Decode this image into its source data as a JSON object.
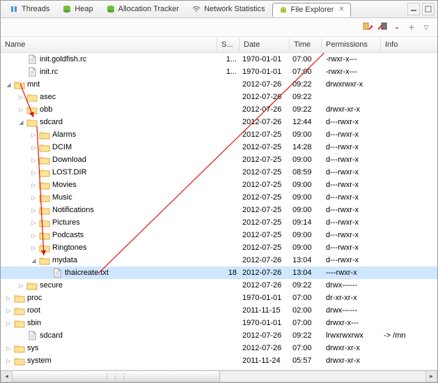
{
  "tabs": [
    {
      "label": "Threads",
      "icon": "threads"
    },
    {
      "label": "Heap",
      "icon": "heap"
    },
    {
      "label": "Allocation Tracker",
      "icon": "heap"
    },
    {
      "label": "Network Statistics",
      "icon": "net"
    },
    {
      "label": "File Explorer",
      "icon": "android",
      "active": true
    }
  ],
  "toolbar": {
    "push_label": "push-file",
    "pull_label": "pull-file",
    "delete_label": "-",
    "add_label": "+"
  },
  "columns": {
    "name": "Name",
    "size": "S...",
    "date": "Date",
    "time": "Time",
    "permissions": "Permissions",
    "info": "Info"
  },
  "rows": [
    {
      "indent": 1,
      "toggle": "",
      "icon": "file",
      "name": "init.goldfish.rc",
      "size": "1...",
      "date": "1970-01-01",
      "time": "07:00",
      "perm": "-rwxr-x---",
      "info": ""
    },
    {
      "indent": 1,
      "toggle": "",
      "icon": "file",
      "name": "init.rc",
      "size": "1...",
      "date": "1970-01-01",
      "time": "07:00",
      "perm": "-rwxr-x---",
      "info": ""
    },
    {
      "indent": 0,
      "toggle": "▿",
      "icon": "folder",
      "name": "mnt",
      "size": "",
      "date": "2012-07-26",
      "time": "09:22",
      "perm": "drwxrwxr-x",
      "info": ""
    },
    {
      "indent": 1,
      "toggle": "▹",
      "icon": "folder",
      "name": "asec",
      "size": "",
      "date": "2012-07-26",
      "time": "09:22",
      "perm": "",
      "info": ""
    },
    {
      "indent": 1,
      "toggle": "▹",
      "icon": "folder",
      "name": "obb",
      "size": "",
      "date": "2012-07-26",
      "time": "09:22",
      "perm": "drwxr-xr-x",
      "info": ""
    },
    {
      "indent": 1,
      "toggle": "▿",
      "icon": "folder",
      "name": "sdcard",
      "size": "",
      "date": "2012-07-26",
      "time": "12:44",
      "perm": "d---rwxr-x",
      "info": ""
    },
    {
      "indent": 2,
      "toggle": "▹",
      "icon": "folder",
      "name": "Alarms",
      "size": "",
      "date": "2012-07-25",
      "time": "09:00",
      "perm": "d---rwxr-x",
      "info": ""
    },
    {
      "indent": 2,
      "toggle": "▹",
      "icon": "folder",
      "name": "DCIM",
      "size": "",
      "date": "2012-07-25",
      "time": "14:28",
      "perm": "d---rwxr-x",
      "info": ""
    },
    {
      "indent": 2,
      "toggle": "▹",
      "icon": "folder",
      "name": "Download",
      "size": "",
      "date": "2012-07-25",
      "time": "09:00",
      "perm": "d---rwxr-x",
      "info": ""
    },
    {
      "indent": 2,
      "toggle": "▹",
      "icon": "folder",
      "name": "LOST.DIR",
      "size": "",
      "date": "2012-07-25",
      "time": "08:59",
      "perm": "d---rwxr-x",
      "info": ""
    },
    {
      "indent": 2,
      "toggle": "▹",
      "icon": "folder",
      "name": "Movies",
      "size": "",
      "date": "2012-07-25",
      "time": "09:00",
      "perm": "d---rwxr-x",
      "info": ""
    },
    {
      "indent": 2,
      "toggle": "▹",
      "icon": "folder",
      "name": "Music",
      "size": "",
      "date": "2012-07-25",
      "time": "09:00",
      "perm": "d---rwxr-x",
      "info": ""
    },
    {
      "indent": 2,
      "toggle": "▹",
      "icon": "folder",
      "name": "Notifications",
      "size": "",
      "date": "2012-07-25",
      "time": "09:00",
      "perm": "d---rwxr-x",
      "info": ""
    },
    {
      "indent": 2,
      "toggle": "▹",
      "icon": "folder",
      "name": "Pictures",
      "size": "",
      "date": "2012-07-25",
      "time": "09:14",
      "perm": "d---rwxr-x",
      "info": ""
    },
    {
      "indent": 2,
      "toggle": "▹",
      "icon": "folder",
      "name": "Podcasts",
      "size": "",
      "date": "2012-07-25",
      "time": "09:00",
      "perm": "d---rwxr-x",
      "info": ""
    },
    {
      "indent": 2,
      "toggle": "▹",
      "icon": "folder",
      "name": "Ringtones",
      "size": "",
      "date": "2012-07-25",
      "time": "09:00",
      "perm": "d---rwxr-x",
      "info": ""
    },
    {
      "indent": 2,
      "toggle": "▿",
      "icon": "folder",
      "name": "mydata",
      "size": "",
      "date": "2012-07-26",
      "time": "13:04",
      "perm": "d---rwxr-x",
      "info": ""
    },
    {
      "indent": 3,
      "toggle": "",
      "icon": "file",
      "name": "thaicreate.txt",
      "size": "18",
      "date": "2012-07-26",
      "time": "13:04",
      "perm": "----rwxr-x",
      "info": "",
      "selected": true
    },
    {
      "indent": 1,
      "toggle": "▹",
      "icon": "folder",
      "name": "secure",
      "size": "",
      "date": "2012-07-26",
      "time": "09:22",
      "perm": "drwx------",
      "info": ""
    },
    {
      "indent": 0,
      "toggle": "▹",
      "icon": "folder",
      "name": "proc",
      "size": "",
      "date": "1970-01-01",
      "time": "07:00",
      "perm": "dr-xr-xr-x",
      "info": ""
    },
    {
      "indent": 0,
      "toggle": "▹",
      "icon": "folder",
      "name": "root",
      "size": "",
      "date": "2011-11-15",
      "time": "02:00",
      "perm": "drwx------",
      "info": ""
    },
    {
      "indent": 0,
      "toggle": "▹",
      "icon": "folder",
      "name": "sbin",
      "size": "",
      "date": "1970-01-01",
      "time": "07:00",
      "perm": "drwxr-x---",
      "info": ""
    },
    {
      "indent": 1,
      "toggle": "",
      "icon": "file",
      "name": "sdcard",
      "size": "",
      "date": "2012-07-26",
      "time": "09:22",
      "perm": "lrwxrwxrwx",
      "info": "-> /mn"
    },
    {
      "indent": 0,
      "toggle": "▹",
      "icon": "folder",
      "name": "sys",
      "size": "",
      "date": "2012-07-26",
      "time": "07:00",
      "perm": "drwxr-xr-x",
      "info": ""
    },
    {
      "indent": 0,
      "toggle": "▹",
      "icon": "folder",
      "name": "system",
      "size": "",
      "date": "2011-11-24",
      "time": "05:57",
      "perm": "drwxr-xr-x",
      "info": ""
    }
  ]
}
